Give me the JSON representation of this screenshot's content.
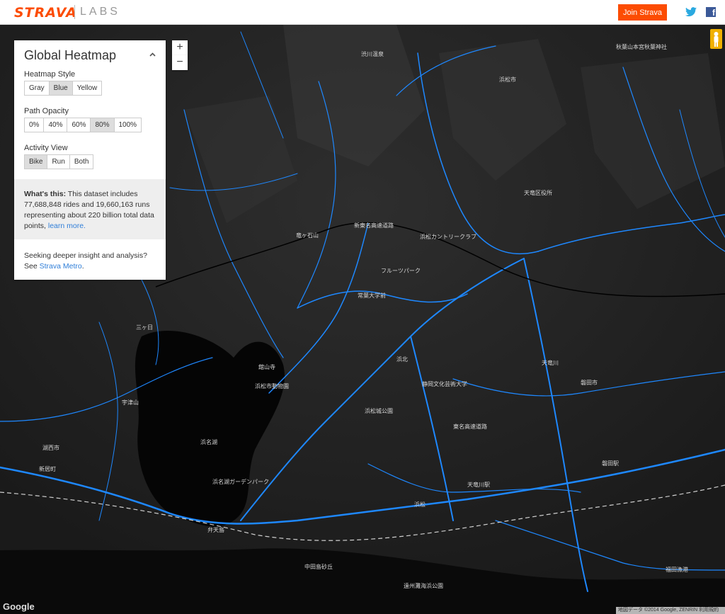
{
  "header": {
    "brand": "STRAVA",
    "brand_sub": "LABS",
    "join_label": "Join Strava",
    "twitter_icon": "twitter-icon",
    "facebook_icon": "facebook-icon",
    "facebook_glyph": "f"
  },
  "panel": {
    "title": "Global Heatmap",
    "collapse_icon": "chevron-up-icon",
    "style_label": "Heatmap Style",
    "style_options": [
      "Gray",
      "Blue",
      "Yellow"
    ],
    "style_selected": "Blue",
    "opacity_label": "Path Opacity",
    "opacity_options": [
      "0%",
      "40%",
      "60%",
      "80%",
      "100%"
    ],
    "opacity_selected": "80%",
    "activity_label": "Activity View",
    "activity_options": [
      "Bike",
      "Run",
      "Both"
    ],
    "activity_selected": "Bike",
    "info_bold": "What's this:",
    "info_text": " This dataset includes 77,688,848 rides and 19,660,163 runs representing about 220 billion total data points, ",
    "info_link": "learn more.",
    "seek_text": "Seeking deeper insight and analysis? See ",
    "seek_link": "Strava Metro",
    "seek_end": "."
  },
  "map_controls": {
    "zoom_in": "+",
    "zoom_out": "−",
    "pegman_icon": "pegman-icon"
  },
  "map": {
    "accent": "#1e88ff",
    "labels": [
      {
        "t": "浜松市"
      },
      {
        "t": "浜名湖"
      },
      {
        "t": "東名高速道路"
      },
      {
        "t": "新東名高速道路"
      },
      {
        "t": "天竜川"
      },
      {
        "t": "弁天島"
      },
      {
        "t": "浜松"
      },
      {
        "t": "浜松城公園"
      },
      {
        "t": "浜松市動物園"
      },
      {
        "t": "宇津山"
      },
      {
        "t": "新居町"
      },
      {
        "t": "三ヶ日"
      },
      {
        "t": "浜北"
      },
      {
        "t": "磐田市"
      },
      {
        "t": "天竜川駅"
      },
      {
        "t": "浜松カントリークラブ"
      },
      {
        "t": "フルーツパーク"
      },
      {
        "t": "遠州灘海浜公園"
      },
      {
        "t": "中田島砂丘"
      },
      {
        "t": "湖西市"
      },
      {
        "t": "磐田駅"
      },
      {
        "t": "福田漁港"
      },
      {
        "t": "竜ヶ石山"
      },
      {
        "t": "常葉大学前"
      },
      {
        "t": "秋葉山本宮秋葉神社"
      },
      {
        "t": "渋川温泉"
      },
      {
        "t": "天竜区役所"
      },
      {
        "t": "浜名湖ガーデンパーク"
      },
      {
        "t": "舘山寺"
      },
      {
        "t": "静岡文化芸術大学"
      }
    ],
    "google_logo": "Google",
    "attribution": "地図データ ©2014 Google, ZENRIN   利用規約"
  }
}
